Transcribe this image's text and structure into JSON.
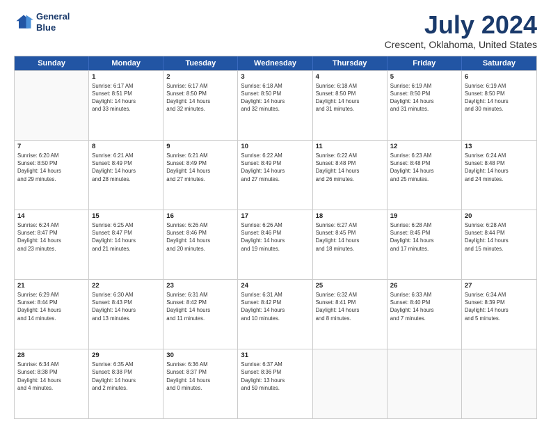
{
  "logo": {
    "line1": "General",
    "line2": "Blue"
  },
  "title": "July 2024",
  "subtitle": "Crescent, Oklahoma, United States",
  "header_days": [
    "Sunday",
    "Monday",
    "Tuesday",
    "Wednesday",
    "Thursday",
    "Friday",
    "Saturday"
  ],
  "weeks": [
    [
      {
        "day": "",
        "info": ""
      },
      {
        "day": "1",
        "info": "Sunrise: 6:17 AM\nSunset: 8:51 PM\nDaylight: 14 hours\nand 33 minutes."
      },
      {
        "day": "2",
        "info": "Sunrise: 6:17 AM\nSunset: 8:50 PM\nDaylight: 14 hours\nand 32 minutes."
      },
      {
        "day": "3",
        "info": "Sunrise: 6:18 AM\nSunset: 8:50 PM\nDaylight: 14 hours\nand 32 minutes."
      },
      {
        "day": "4",
        "info": "Sunrise: 6:18 AM\nSunset: 8:50 PM\nDaylight: 14 hours\nand 31 minutes."
      },
      {
        "day": "5",
        "info": "Sunrise: 6:19 AM\nSunset: 8:50 PM\nDaylight: 14 hours\nand 31 minutes."
      },
      {
        "day": "6",
        "info": "Sunrise: 6:19 AM\nSunset: 8:50 PM\nDaylight: 14 hours\nand 30 minutes."
      }
    ],
    [
      {
        "day": "7",
        "info": "Sunrise: 6:20 AM\nSunset: 8:50 PM\nDaylight: 14 hours\nand 29 minutes."
      },
      {
        "day": "8",
        "info": "Sunrise: 6:21 AM\nSunset: 8:49 PM\nDaylight: 14 hours\nand 28 minutes."
      },
      {
        "day": "9",
        "info": "Sunrise: 6:21 AM\nSunset: 8:49 PM\nDaylight: 14 hours\nand 27 minutes."
      },
      {
        "day": "10",
        "info": "Sunrise: 6:22 AM\nSunset: 8:49 PM\nDaylight: 14 hours\nand 27 minutes."
      },
      {
        "day": "11",
        "info": "Sunrise: 6:22 AM\nSunset: 8:48 PM\nDaylight: 14 hours\nand 26 minutes."
      },
      {
        "day": "12",
        "info": "Sunrise: 6:23 AM\nSunset: 8:48 PM\nDaylight: 14 hours\nand 25 minutes."
      },
      {
        "day": "13",
        "info": "Sunrise: 6:24 AM\nSunset: 8:48 PM\nDaylight: 14 hours\nand 24 minutes."
      }
    ],
    [
      {
        "day": "14",
        "info": "Sunrise: 6:24 AM\nSunset: 8:47 PM\nDaylight: 14 hours\nand 23 minutes."
      },
      {
        "day": "15",
        "info": "Sunrise: 6:25 AM\nSunset: 8:47 PM\nDaylight: 14 hours\nand 21 minutes."
      },
      {
        "day": "16",
        "info": "Sunrise: 6:26 AM\nSunset: 8:46 PM\nDaylight: 14 hours\nand 20 minutes."
      },
      {
        "day": "17",
        "info": "Sunrise: 6:26 AM\nSunset: 8:46 PM\nDaylight: 14 hours\nand 19 minutes."
      },
      {
        "day": "18",
        "info": "Sunrise: 6:27 AM\nSunset: 8:45 PM\nDaylight: 14 hours\nand 18 minutes."
      },
      {
        "day": "19",
        "info": "Sunrise: 6:28 AM\nSunset: 8:45 PM\nDaylight: 14 hours\nand 17 minutes."
      },
      {
        "day": "20",
        "info": "Sunrise: 6:28 AM\nSunset: 8:44 PM\nDaylight: 14 hours\nand 15 minutes."
      }
    ],
    [
      {
        "day": "21",
        "info": "Sunrise: 6:29 AM\nSunset: 8:44 PM\nDaylight: 14 hours\nand 14 minutes."
      },
      {
        "day": "22",
        "info": "Sunrise: 6:30 AM\nSunset: 8:43 PM\nDaylight: 14 hours\nand 13 minutes."
      },
      {
        "day": "23",
        "info": "Sunrise: 6:31 AM\nSunset: 8:42 PM\nDaylight: 14 hours\nand 11 minutes."
      },
      {
        "day": "24",
        "info": "Sunrise: 6:31 AM\nSunset: 8:42 PM\nDaylight: 14 hours\nand 10 minutes."
      },
      {
        "day": "25",
        "info": "Sunrise: 6:32 AM\nSunset: 8:41 PM\nDaylight: 14 hours\nand 8 minutes."
      },
      {
        "day": "26",
        "info": "Sunrise: 6:33 AM\nSunset: 8:40 PM\nDaylight: 14 hours\nand 7 minutes."
      },
      {
        "day": "27",
        "info": "Sunrise: 6:34 AM\nSunset: 8:39 PM\nDaylight: 14 hours\nand 5 minutes."
      }
    ],
    [
      {
        "day": "28",
        "info": "Sunrise: 6:34 AM\nSunset: 8:38 PM\nDaylight: 14 hours\nand 4 minutes."
      },
      {
        "day": "29",
        "info": "Sunrise: 6:35 AM\nSunset: 8:38 PM\nDaylight: 14 hours\nand 2 minutes."
      },
      {
        "day": "30",
        "info": "Sunrise: 6:36 AM\nSunset: 8:37 PM\nDaylight: 14 hours\nand 0 minutes."
      },
      {
        "day": "31",
        "info": "Sunrise: 6:37 AM\nSunset: 8:36 PM\nDaylight: 13 hours\nand 59 minutes."
      },
      {
        "day": "",
        "info": ""
      },
      {
        "day": "",
        "info": ""
      },
      {
        "day": "",
        "info": ""
      }
    ]
  ]
}
